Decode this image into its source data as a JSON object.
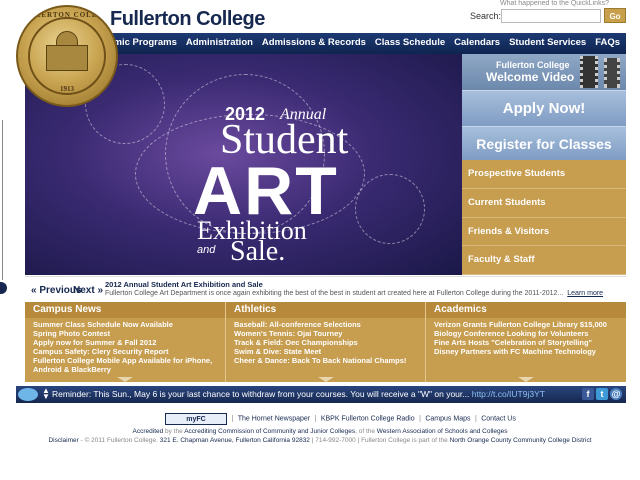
{
  "header": {
    "seal_top_text": "FULLERTON COLLEGE",
    "seal_year": "1913",
    "brand": "Fullerton College",
    "quicklinks_text": "What happened to the QuickLinks?",
    "search_label": "Search:",
    "search_value": "",
    "search_go": "Go"
  },
  "nav": {
    "items": [
      "Academic Programs",
      "Administration",
      "Admissions & Records",
      "Class Schedule",
      "Calendars",
      "Student Services",
      "FAQs"
    ]
  },
  "hero": {
    "year": "2012",
    "annual": "Annual",
    "student": "Student",
    "art": "ART",
    "exhibition": "Exhibition",
    "and": "and",
    "sale": "Sale."
  },
  "right_panel": {
    "welcome_line1": "Fullerton College",
    "welcome_line2": "Welcome Video",
    "apply": "Apply Now!",
    "register": "Register for Classes",
    "audiences": [
      "Prospective Students",
      "Current Students",
      "Friends & Visitors",
      "Faculty & Staff"
    ]
  },
  "caption": {
    "prev": "« Previous",
    "next": "Next »",
    "title": "2012 Annual Student Art Exhibition and Sale",
    "body": "Fullerton College Art Department is once again exhibiting the best of the best in student art created here at Fullerton College during the 2011-2012...",
    "learn_more": "Learn more"
  },
  "columns": [
    {
      "title": "Campus News",
      "items": [
        "Summer Class Schedule Now Available",
        "Spring Photo Contest",
        "Apply now for Summer & Fall 2012",
        "Campus Safety: Clery Security Report",
        "Fullerton College Mobile App Available for iPhone,",
        "Android & BlackBerry"
      ]
    },
    {
      "title": "Athletics",
      "items": [
        "Baseball: All-conference Selections",
        "Women's Tennis: Ojai Tourney",
        "Track & Field: Oec Championships",
        "Swim & Dive: State Meet",
        "Cheer & Dance: Back To Back National Champs!"
      ]
    },
    {
      "title": "Academics",
      "items": [
        "Verizon Grants Fullerton College Library $15,000",
        "Biology Conference Looking for Volunteers",
        "Fine Arts Hosts \"Celebration of Storytelling\"",
        "Disney Partners with FC Machine Technology"
      ]
    }
  ],
  "twitter": {
    "message": "Reminder: This Sun., May 6 is your last chance to withdraw from your courses. You will receive a \"W\" on your...",
    "link": "http://t.co/IUT9j3YT",
    "social": [
      "f",
      "t",
      "@"
    ]
  },
  "footer": {
    "myfc": "myFC",
    "links": [
      "The Hornet Newspaper",
      "KBPK Fullerton College Radio",
      "Campus Maps",
      "Contact Us"
    ],
    "accredited_prefix": "Accredited",
    "accredited_by": "by the",
    "accrediting_commission": "Accrediting Commission of Community and Junior Colleges",
    "of_the": ", of the",
    "western_association": "Western Association of Schools and Colleges",
    "disclaimer": "Disclaimer",
    "copyright": "- © 2011 Fullerton College",
    "address": "321 E. Chapman Avenue, Fullerton California 92832",
    "phone": "714-992-7000",
    "district_prefix": "Fullerton College is part of the",
    "district": "North Orange County Community College District"
  }
}
